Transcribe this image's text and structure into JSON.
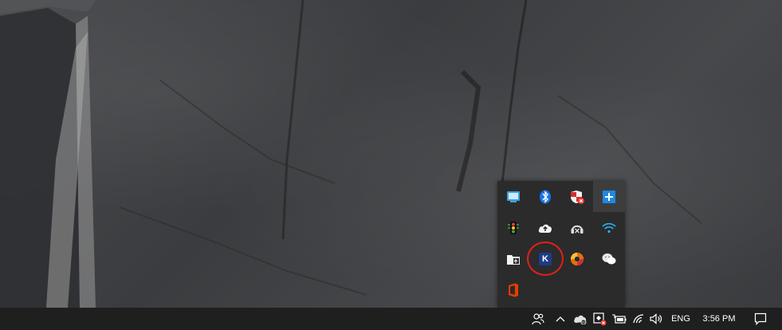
{
  "taskbar": {
    "language": "ENG",
    "clock": "3:56 PM"
  },
  "tray_flyout": {
    "rows": [
      [
        {
          "icon": "network-adapter-icon"
        },
        {
          "icon": "bluetooth-icon"
        },
        {
          "icon": "security-shield-alert-icon"
        },
        {
          "icon": "plus-app-icon"
        }
      ],
      [
        {
          "icon": "traffic-light-icon"
        },
        {
          "icon": "cloud-upload-icon"
        },
        {
          "icon": "headset-icon"
        },
        {
          "icon": "wifi-icon"
        }
      ],
      [
        {
          "icon": "folder-sync-icon"
        },
        {
          "icon": "k-app-icon",
          "label": "K"
        },
        {
          "icon": "lifebuoy-icon"
        },
        {
          "icon": "wechat-icon"
        }
      ],
      [
        {
          "icon": "office-icon"
        }
      ]
    ]
  },
  "colors": {
    "taskbar_bg": "#1f1f1f",
    "flyout_bg": "#2b2b2b",
    "highlight_ring": "#e0201b",
    "k_app_bg": "#1e3a8a"
  }
}
